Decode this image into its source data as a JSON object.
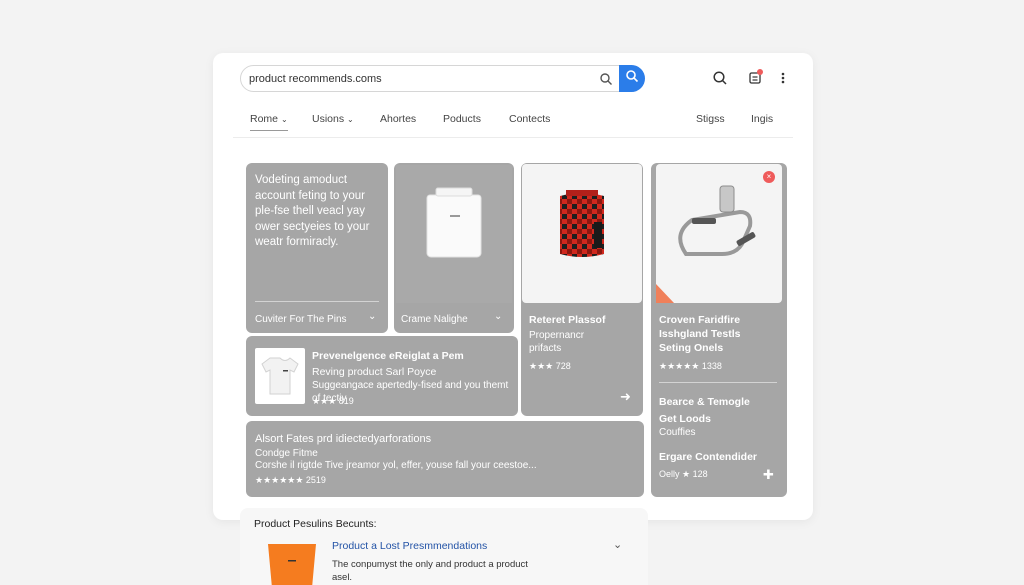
{
  "search": {
    "value": "product recommends.coms"
  },
  "nav": {
    "items": [
      "Rome",
      "Usions",
      "Ahortes",
      "Poducts",
      "Contects"
    ],
    "right": [
      "Stigss",
      "Ingis"
    ]
  },
  "cards": {
    "intro": {
      "text": [
        "Vodeting amoduct",
        "account feting to your",
        "ple-fse thell veacl yay",
        "ower sectyeies to your",
        "weatr formiracly."
      ],
      "footer": "Cuviter For The Pins"
    },
    "crame": {
      "footer": "Crame Nalighe"
    },
    "reteret": {
      "title": "Reteret Plassof",
      "sub1": "Propernancr",
      "sub2": "prifacts",
      "rating": "★★★ 728"
    },
    "croven": {
      "title": [
        "Croven Faridfire",
        "Isshgland Testls",
        "Seting Onels"
      ],
      "rating": "★★★★★ 1338",
      "section_title": [
        "Bearce & Temogle",
        "Get Loods"
      ],
      "section_sub": "Couffies",
      "section2_title": "Ergare Contendider",
      "section2_rating": "Oelly ★ 128"
    },
    "preven": {
      "title": "Prevenelgence eReiglat a Pem",
      "line2": "Reving product Sarl Poyce",
      "line3": "Suggeangace apertedly-fised and you themt of tectiy",
      "rating": "★★★ 819"
    },
    "alsort": {
      "title": "Alsort Fates prd idiectedyarforations",
      "line2": "Condge Fitme",
      "line3": "Corshe il rigtde Tive jreamor yol, effer, youse fall your ceestoe...",
      "rating": "★★★★★★ 2519"
    }
  },
  "results": {
    "header": "Product Pesulins Becunts:",
    "item_title": "Product a Lost Presmmendations",
    "item_desc1": "The conpumyst the only and product a product",
    "item_desc2": "asel."
  },
  "colors": {
    "accent": "#2b7de9",
    "card": "#a6a6a6",
    "badge": "#ef5b5b"
  }
}
